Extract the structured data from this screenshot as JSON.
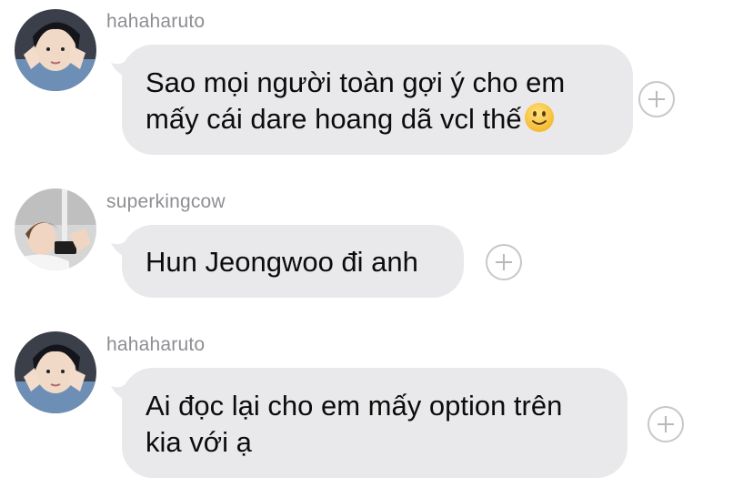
{
  "messages": [
    {
      "username": "hahaharuto",
      "lines": [
        "Sao mọi người toàn gợi ý cho em",
        "mấy cái dare hoang dã vcl thế"
      ],
      "emoji": "slightly-smiling-face",
      "avatar": "hahaharuto-avatar"
    },
    {
      "username": "superkingcow",
      "lines": [
        "Hun Jeongwoo đi anh"
      ],
      "avatar": "superkingcow-avatar"
    },
    {
      "username": "hahaharuto",
      "lines": [
        "Ai đọc lại cho em mấy option trên",
        "kia với ạ"
      ],
      "avatar": "hahaharuto-avatar"
    }
  ],
  "icons": {
    "react": "add-reaction-icon"
  },
  "colors": {
    "bubble": "#e9e9eb",
    "username": "#8e8e93",
    "text": "#0c0c0c",
    "react_border": "#c7c7cc"
  }
}
